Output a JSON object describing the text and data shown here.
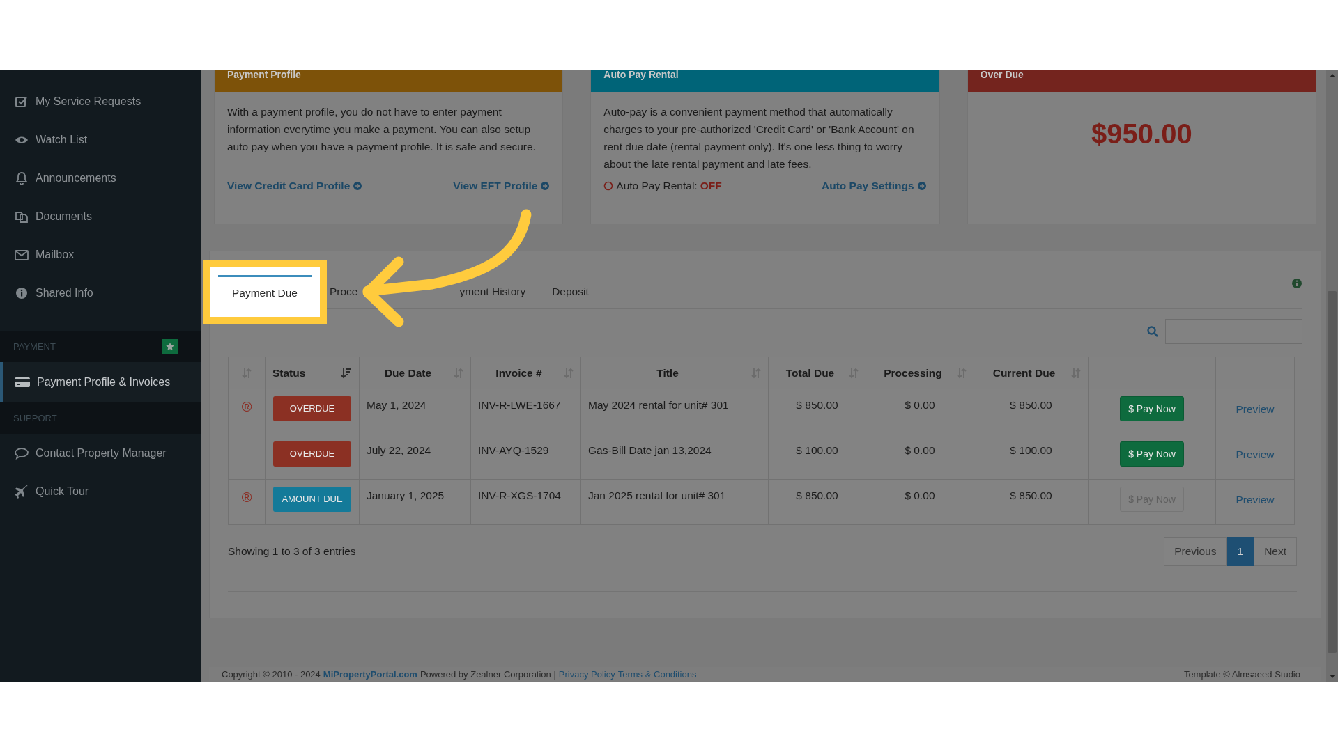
{
  "sidebar": {
    "sections": [
      {
        "items": [
          {
            "label": "My Service Requests",
            "selected": false
          },
          {
            "label": "Watch List",
            "selected": false
          },
          {
            "label": "Announcements",
            "selected": false
          },
          {
            "label": "Documents",
            "selected": false
          },
          {
            "label": "Mailbox",
            "selected": false
          },
          {
            "label": "Shared Info",
            "selected": false
          }
        ]
      },
      {
        "heading": "PAYMENT",
        "starred": true,
        "items": [
          {
            "label": "Payment Profile & Invoices",
            "selected": true
          }
        ]
      },
      {
        "heading": "SUPPORT",
        "items": [
          {
            "label": "Contact Property Manager",
            "selected": false
          },
          {
            "label": "Quick Tour",
            "selected": false
          }
        ]
      }
    ]
  },
  "cards": [
    {
      "kind": "profile",
      "title": "Payment Profile",
      "color": "#7d5209",
      "text": "With a payment profile, you do not have to enter payment information everytime you make a payment. You can also setup auto pay when you have a payment profile. It is safe and secure.",
      "links": [
        "View Credit Card Profile",
        "View EFT Profile"
      ]
    },
    {
      "kind": "autopay",
      "title": "Auto Pay Rental",
      "color": "#006478",
      "text": "Auto-pay is a convenient payment method that automatically charges to your pre-authorized 'Credit Card' or 'Bank Account' on rent due date (rental payment only). It's one less thing to worry about the late rental payment and late fees.",
      "status": {
        "label": "Auto Pay Rental:",
        "value": "OFF",
        "on": false
      },
      "links": [
        "Auto Pay Settings"
      ]
    },
    {
      "kind": "amount",
      "title": "Over Due",
      "color": "#74241e",
      "amount": "$950.00"
    }
  ],
  "invoices": {
    "tabs": [
      {
        "label": "Payment Due",
        "selected": true
      },
      {
        "label": "Proce",
        "selected": false
      },
      {
        "label": "yment History",
        "selected": false
      },
      {
        "label": "Deposit",
        "selected": false
      }
    ],
    "columns": [
      {
        "sorted": false
      },
      {
        "label": "Status",
        "sorted": true
      },
      {
        "label": "Due Date",
        "sorted": false
      },
      {
        "label": "Invoice #",
        "sorted": false
      },
      {
        "label": "Title",
        "sorted": false
      },
      {
        "label": "Total Due",
        "sorted": false
      },
      {
        "label": "Processing",
        "sorted": false
      },
      {
        "label": "Current Due",
        "sorted": false
      },
      {},
      {}
    ],
    "rows": [
      {
        "mark": "®",
        "status": {
          "label": "OVERDUE",
          "kind": "overdue"
        },
        "due_date": "May 1, 2024",
        "invoice": "INV-R-LWE-1667",
        "title": "May 2024 rental for unit# 301",
        "total_due": "$ 850.00",
        "processing": "$ 0.00",
        "current_due": "$ 850.00",
        "pay": {
          "label": "$ Pay Now",
          "disabled": false
        },
        "preview": "Preview"
      },
      {
        "status": {
          "label": "OVERDUE",
          "kind": "overdue"
        },
        "due_date": "July 22, 2024",
        "invoice": "INV-AYQ-1529",
        "title": "Gas-Bill Date jan 13,2024",
        "total_due": "$ 100.00",
        "processing": "$ 0.00",
        "current_due": "$ 100.00",
        "pay": {
          "label": "$ Pay Now",
          "disabled": false
        },
        "preview": "Preview"
      },
      {
        "mark": "®",
        "status": {
          "label": "AMOUNT DUE",
          "kind": "amount_due"
        },
        "due_date": "January 1, 2025",
        "invoice": "INV-R-XGS-1704",
        "title": "Jan 2025 rental for unit# 301",
        "total_due": "$ 850.00",
        "processing": "$ 0.00",
        "current_due": "$ 850.00",
        "pay": {
          "label": "$ Pay Now",
          "disabled": true
        },
        "preview": "Preview"
      }
    ],
    "info": "Showing 1 to 3 of 3 entries",
    "pagination": [
      {
        "label": "Previous",
        "selected": false
      },
      {
        "label": "1",
        "selected": true
      },
      {
        "label": "Next",
        "selected": false
      }
    ]
  },
  "footer": {
    "copyright": "Copyright © 2010 - 2024",
    "site": "MiPropertyPortal.com",
    "powered": "Powered by Zealner Corporation |",
    "links": [
      "Privacy Policy",
      "Terms & Conditions"
    ],
    "template": "Template © Almsaeed Studio"
  }
}
